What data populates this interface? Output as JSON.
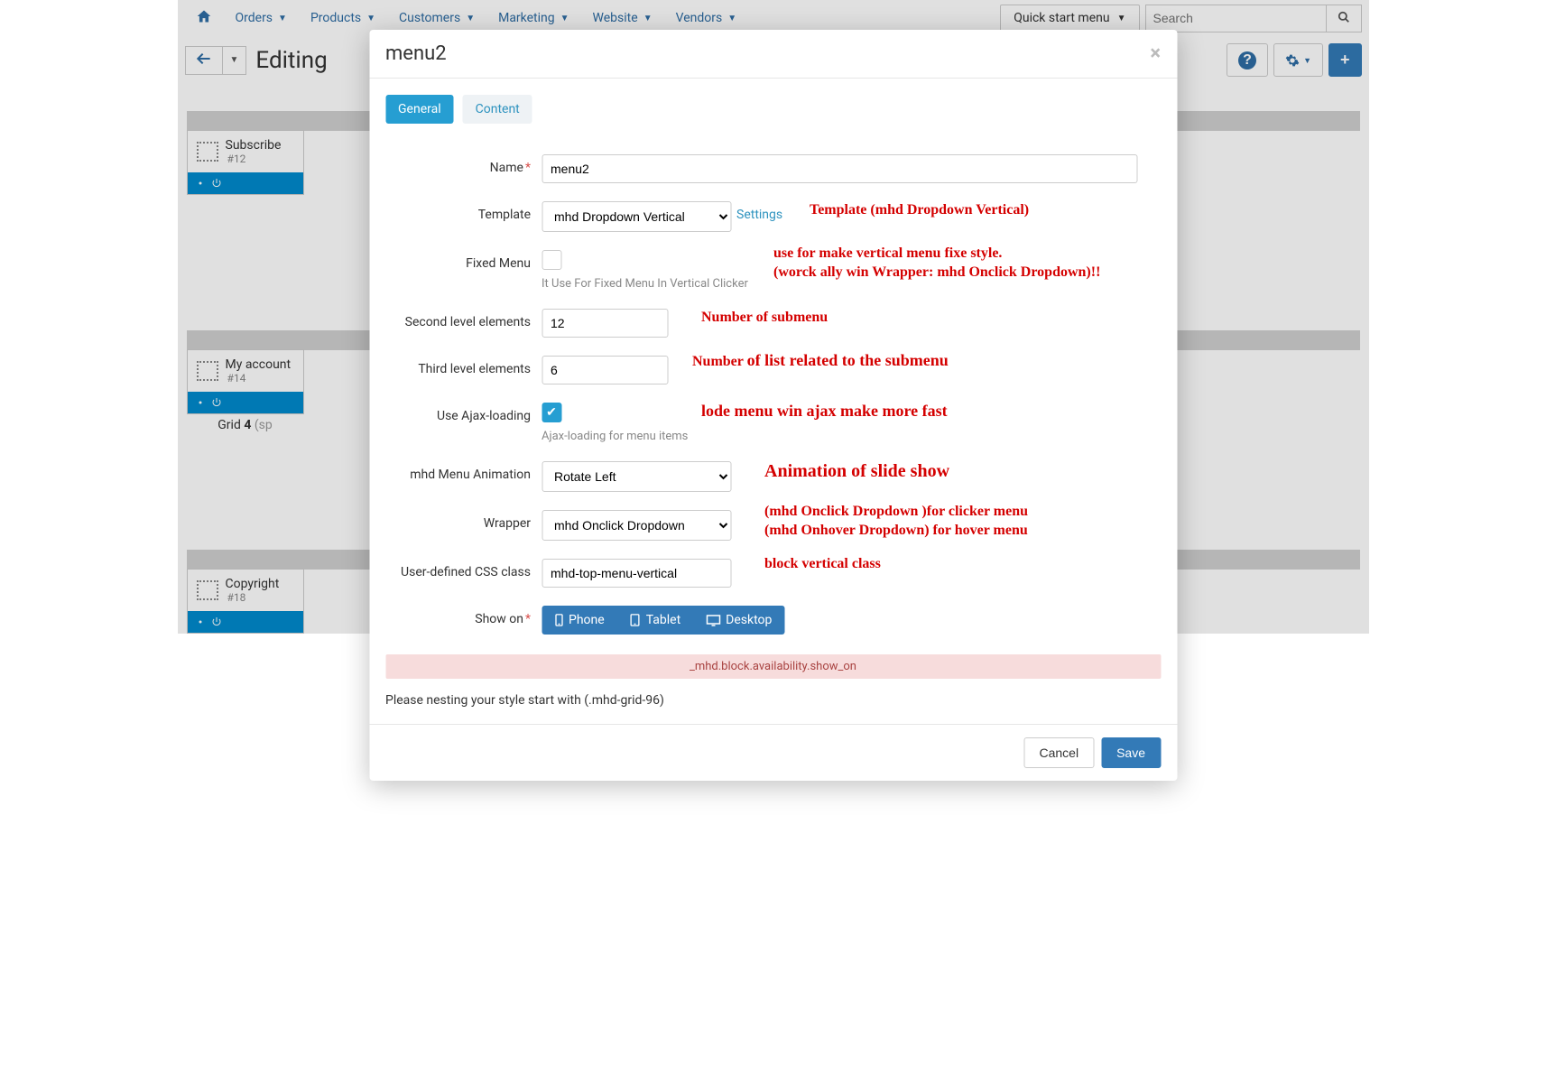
{
  "topbar": {
    "menu": [
      "Orders",
      "Products",
      "Customers",
      "Marketing",
      "Website",
      "Vendors"
    ],
    "quick_start": "Quick start menu",
    "search_placeholder": "Search"
  },
  "subheader": {
    "title": "Editing"
  },
  "bg_blocks": [
    {
      "title": "Subscribe",
      "id": "#12"
    },
    {
      "title": "My account",
      "id": "#14"
    },
    {
      "title": "Copyright",
      "id": "#18"
    }
  ],
  "grid_label_prefix": "Grid ",
  "grid_label_num": "4",
  "grid_label_suffix": " (sp",
  "modal": {
    "title": "menu2",
    "tabs": {
      "general": "General",
      "content": "Content"
    },
    "labels": {
      "name": "Name",
      "template": "Template",
      "fixed": "Fixed Menu",
      "second": "Second level elements",
      "third": "Third level elements",
      "ajax": "Use Ajax-loading",
      "anim": "mhd Menu Animation",
      "wrapper": "Wrapper",
      "css": "User-defined CSS class",
      "showon": "Show on"
    },
    "values": {
      "name": "menu2",
      "template": "mhd Dropdown Vertical",
      "settings": "Settings",
      "fixed_help": "It Use For Fixed Menu In Vertical Clicker",
      "second": "12",
      "third": "6",
      "ajax_help": "Ajax-loading for menu items",
      "anim": "Rotate Left",
      "wrapper": "mhd Onclick Dropdown",
      "css": "mhd-top-menu-vertical"
    },
    "showon": [
      "Phone",
      "Tablet",
      "Desktop"
    ],
    "availability": "_mhd.block.availability.show_on",
    "nesting": "Please nesting your style start with (.mhd-grid-96)",
    "cancel": "Cancel",
    "save": "Save"
  },
  "annot": {
    "template": "Template (mhd Dropdown Vertical)",
    "fixed1": "use for make vertical menu fixe style.",
    "fixed2": "(worck ally win Wrapper: mhd Onclick Dropdown)!!",
    "second": "Number of submenu",
    "third_a": "Number ",
    "third_b": "of list related to the submenu",
    "ajax": "lode menu win ajax make more fast",
    "anim": "Animation of slide show",
    "wrap1": "(mhd Onclick Dropdown )for clicker menu",
    "wrap2": "(mhd Onhover Dropdown) for hover menu",
    "css": "block vertical class"
  }
}
